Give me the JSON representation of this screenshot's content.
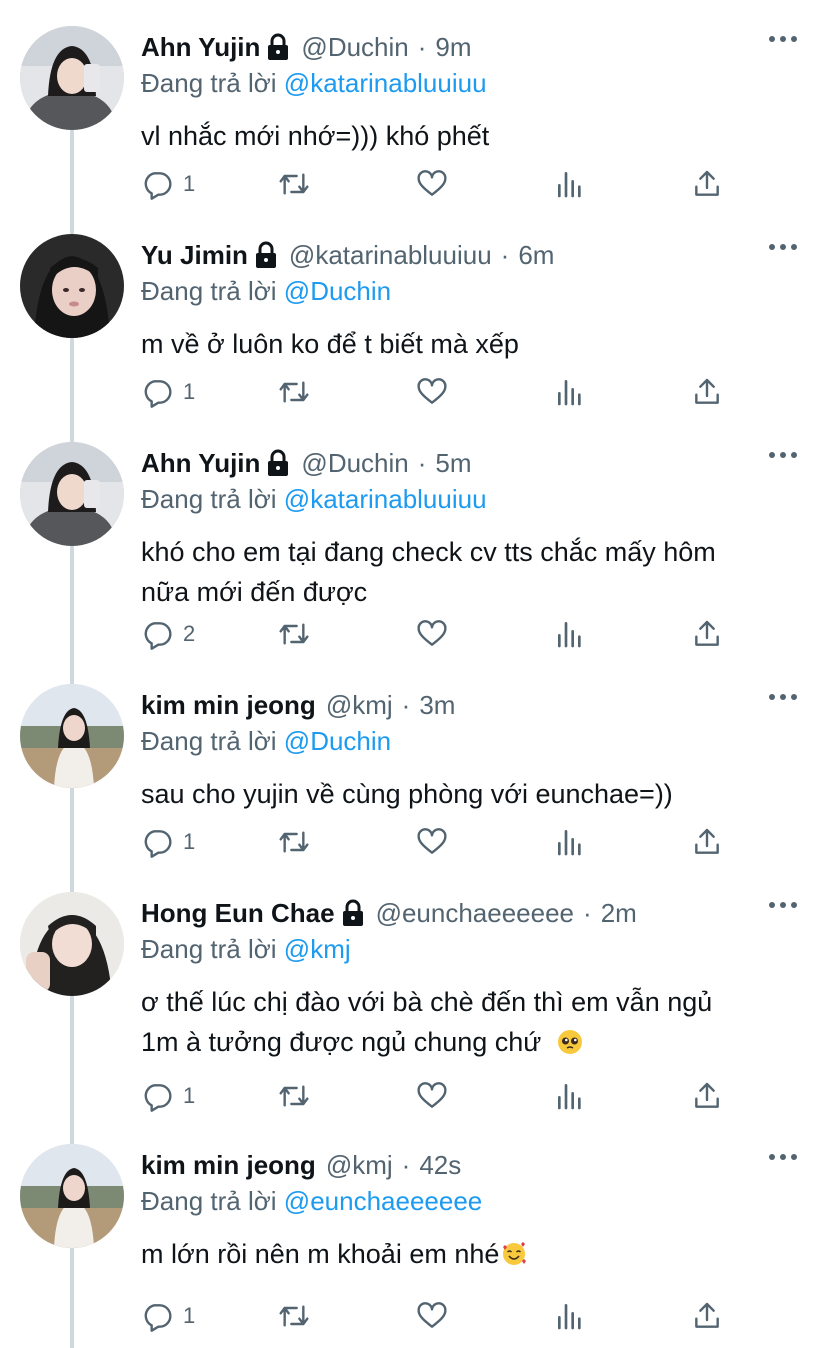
{
  "tweets": [
    {
      "name": "Ahn Yujin",
      "locked": true,
      "handle": "@Duchin",
      "time": "9m",
      "reply_prefix": "Đang trả lời",
      "reply_to": "@katarinabluuiuu",
      "lines": [
        "vl nhắc mới nhớ=))) khó phết"
      ],
      "replies": "1",
      "avatar": "yujin"
    },
    {
      "name": "Yu Jimin",
      "locked": true,
      "handle": "@katarinabluuiuu",
      "time": "6m",
      "reply_prefix": "Đang trả lời",
      "reply_to": "@Duchin",
      "lines": [
        "m về ở luôn ko để t biết mà xếp"
      ],
      "replies": "1",
      "avatar": "jimin"
    },
    {
      "name": "Ahn Yujin",
      "locked": true,
      "handle": "@Duchin",
      "time": "5m",
      "reply_prefix": "Đang trả lời",
      "reply_to": "@katarinabluuiuu",
      "lines": [
        "khó cho em tại đang check cv tts chắc mấy hôm",
        "nữa mới đến được"
      ],
      "replies": "2",
      "avatar": "yujin"
    },
    {
      "name": "kim min jeong",
      "locked": false,
      "handle": "@kmj",
      "time": "3m",
      "reply_prefix": "Đang trả lời",
      "reply_to": "@Duchin",
      "lines": [
        "sau cho yujin về cùng phòng với eunchae=))"
      ],
      "replies": "1",
      "avatar": "minjeong"
    },
    {
      "name": "Hong Eun Chae",
      "locked": true,
      "handle": "@eunchaeeeeee",
      "time": "2m",
      "reply_prefix": "Đang trả lời",
      "reply_to": "@kmj",
      "lines": [
        "ơ thế lúc chị đào với bà chè đến thì em vẫn ngủ",
        "1m à tưởng được ngủ chung chứ"
      ],
      "emoji": "pleading-face-emoji",
      "replies": "1",
      "avatar": "eunchae"
    },
    {
      "name": "kim min jeong",
      "locked": false,
      "handle": "@kmj",
      "time": "42s",
      "reply_prefix": "Đang trả lời",
      "reply_to": "@eunchaeeeeee",
      "lines": [
        "m lớn rồi nên m khoải em nhé"
      ],
      "emoji": "smiling-face-with-hearts-emoji",
      "replies": "1",
      "avatar": "minjeong"
    }
  ],
  "icons": [
    "lock-icon",
    "more-icon",
    "reply-icon",
    "retweet-icon",
    "like-icon",
    "views-icon",
    "share-icon"
  ],
  "colors": {
    "text": "#0f1419",
    "secondary": "#536471",
    "mention": "#1d9bf0",
    "thread_line": "#cfd9de"
  }
}
